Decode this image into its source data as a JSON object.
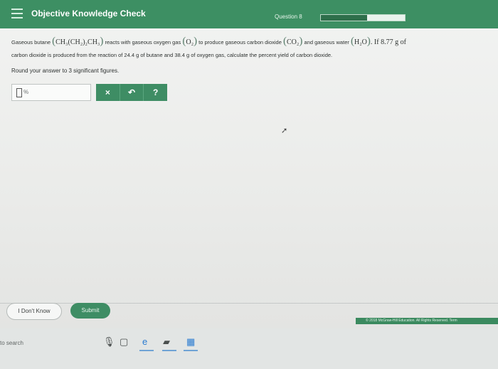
{
  "header": {
    "app_title": "Objective Knowledge Check",
    "question_label": "Question 8",
    "progress_fraction": 0.55
  },
  "question": {
    "line1_a": "Gaseous butane",
    "butane_formula": "CH₃(CH₂)₂CH₃",
    "line1_b": "reacts with gaseous oxygen gas",
    "oxygen_formula": "O₂",
    "line1_c": "to produce gaseous carbon dioxide",
    "co2_formula": "CO₂",
    "line1_d": "and gaseous water",
    "water_formula": "H₂O",
    "line1_e": ". If 8.77 g of",
    "line2": "carbon dioxide is produced from the reaction of 24.4 g of butane and 38.4 g of oxygen gas, calculate the percent yield of carbon dioxide.",
    "round_note": "Round your answer to 3 significant figures."
  },
  "answer": {
    "unit": "%",
    "tools": [
      "×",
      "↶",
      "?"
    ]
  },
  "footer": {
    "dont_know_label": "I Don't Know",
    "submit_label": "Submit",
    "copyright": "© 2018 McGraw-Hill Education. All Rights Reserved. Term"
  },
  "taskbar": {
    "search_text": "to search"
  }
}
